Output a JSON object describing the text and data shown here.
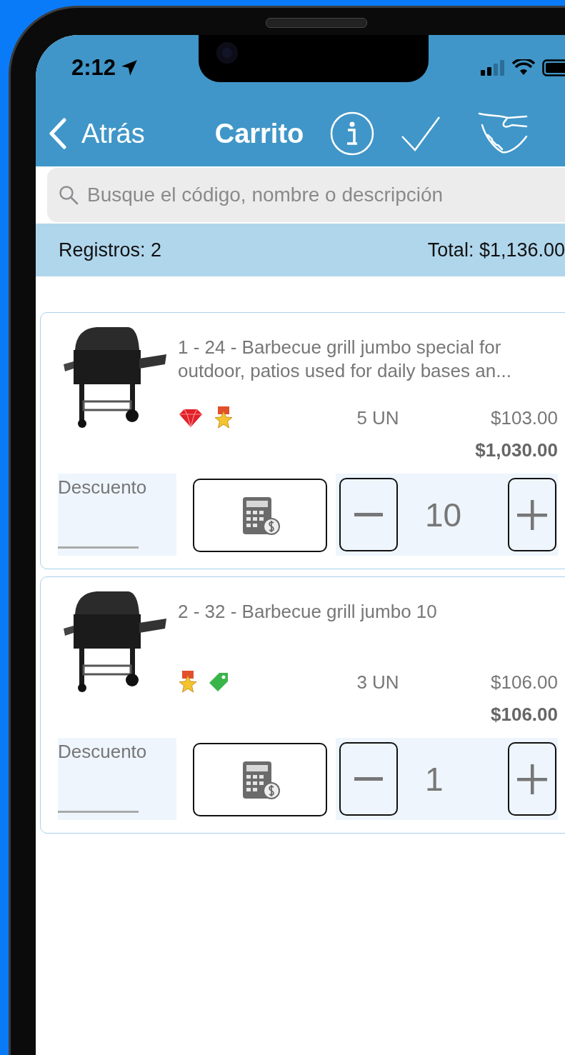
{
  "status_bar": {
    "time": "2:12"
  },
  "nav": {
    "back": "Atrás",
    "title": "Carrito"
  },
  "search": {
    "placeholder": "Busque el código, nombre o descripción"
  },
  "summary": {
    "records": "Registros: 2",
    "total": "Total: $1,136.00"
  },
  "items": [
    {
      "description": "1 - 24 - Barbecue grill jumbo special for outdoor, patios used for daily bases an...",
      "badges": [
        {
          "kind": "gem"
        },
        {
          "kind": "medal"
        }
      ],
      "quantity": "5 UN",
      "unit_price": "$103.00",
      "line_total": "$1,030.00",
      "discount_label": "Descuento",
      "count": "10"
    },
    {
      "description": "2 - 32 - Barbecue grill jumbo 10",
      "badges": [
        {
          "kind": "medal"
        },
        {
          "kind": "tag"
        }
      ],
      "quantity": "3 UN",
      "unit_price": "$106.00",
      "line_total": "$106.00",
      "discount_label": "Descuento",
      "count": "1"
    }
  ]
}
